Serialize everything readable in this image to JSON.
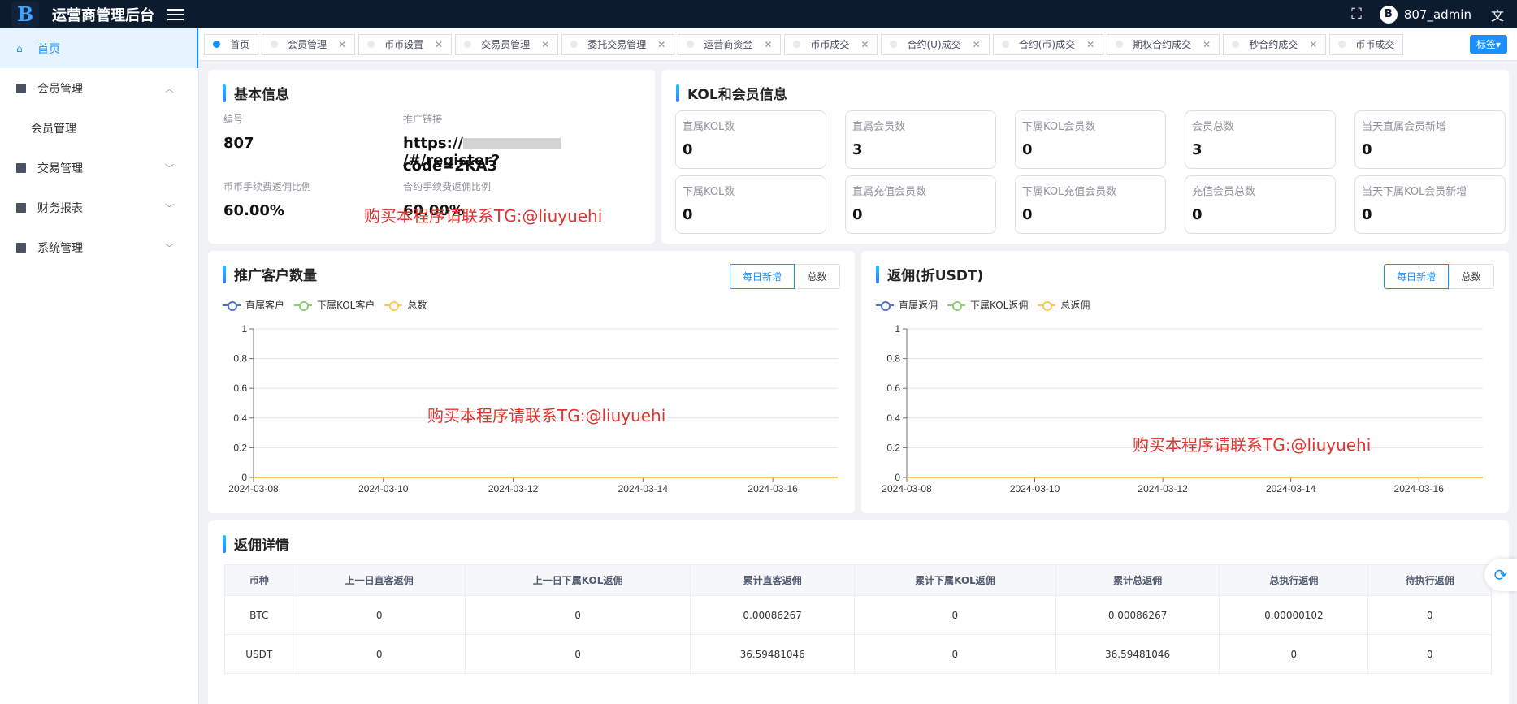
{
  "app": {
    "title": "运营商管理后台",
    "logo_letter": "B",
    "username": "807_admin",
    "avatar_letter": "B"
  },
  "sidebar": {
    "items": [
      {
        "label": "首页"
      },
      {
        "label": "会员管理"
      },
      {
        "label": "会员管理"
      },
      {
        "label": "交易管理"
      },
      {
        "label": "财务报表"
      },
      {
        "label": "系统管理"
      }
    ]
  },
  "tabs": [
    "首页",
    "会员管理",
    "币币设置",
    "交易员管理",
    "委托交易管理",
    "运营商资金",
    "币币成交",
    "合约(U)成交",
    "合约(币)成交",
    "期权合约成交",
    "秒合约成交",
    "币币成交"
  ],
  "tag_button": "标签",
  "basic_info": {
    "title": "基本信息",
    "id_label": "编号",
    "id_value": "807",
    "link_label": "推广链接",
    "link_value_1": "https://",
    "link_value_2": "/#/register?",
    "link_value_3": "code=2KA3",
    "coin_fee_label": "币币手续费返佣比例",
    "coin_fee_value": "60.00%",
    "contract_fee_label": "合约手续费返佣比例",
    "contract_fee_value": "60.00%"
  },
  "watermark": "购买本程序请联系TG:@liuyuehi",
  "kol": {
    "title": "KOL和会员信息",
    "boxes": [
      {
        "label": "直属KOL数",
        "value": "0"
      },
      {
        "label": "直属会员数",
        "value": "3"
      },
      {
        "label": "下属KOL会员数",
        "value": "0"
      },
      {
        "label": "会员总数",
        "value": "3"
      },
      {
        "label": "当天直属会员新增",
        "value": "0"
      },
      {
        "label": "下属KOL数",
        "value": "0"
      },
      {
        "label": "直属充值会员数",
        "value": "0"
      },
      {
        "label": "下属KOL充值会员数",
        "value": "0"
      },
      {
        "label": "充值会员总数",
        "value": "0"
      },
      {
        "label": "当天下属KOL会员新增",
        "value": "0"
      }
    ]
  },
  "promo_chart": {
    "title": "推广客户数量",
    "btn_daily": "每日新增",
    "btn_total": "总数"
  },
  "rebate_chart": {
    "title": "返佣(折USDT)",
    "btn_daily": "每日新增",
    "btn_total": "总数"
  },
  "chart_data": [
    {
      "type": "line",
      "x": [
        "2024-03-08",
        "2024-03-09",
        "2024-03-10",
        "2024-03-11",
        "2024-03-12",
        "2024-03-13",
        "2024-03-14",
        "2024-03-15",
        "2024-03-16",
        "2024-03-17"
      ],
      "x_tick_labels": [
        "2024-03-08",
        "2024-03-10",
        "2024-03-12",
        "2024-03-14",
        "2024-03-16"
      ],
      "series": [
        {
          "name": "直属客户",
          "color": "#5470c6",
          "values": [
            0,
            0,
            0,
            0,
            0,
            0,
            0,
            0,
            0,
            0
          ]
        },
        {
          "name": "下属KOL客户",
          "color": "#91cc75",
          "values": [
            0,
            0,
            0,
            0,
            0,
            0,
            0,
            0,
            0,
            0
          ]
        },
        {
          "name": "总数",
          "color": "#fac858",
          "values": [
            0,
            0,
            0,
            0,
            0,
            0,
            0,
            0,
            0,
            0
          ]
        }
      ],
      "ylim": [
        0,
        1
      ],
      "yticks": [
        0,
        0.2,
        0.4,
        0.6,
        0.8,
        1
      ],
      "grid": true,
      "legend": "top-left"
    },
    {
      "type": "line",
      "x": [
        "2024-03-08",
        "2024-03-09",
        "2024-03-10",
        "2024-03-11",
        "2024-03-12",
        "2024-03-13",
        "2024-03-14",
        "2024-03-15",
        "2024-03-16",
        "2024-03-17"
      ],
      "x_tick_labels": [
        "2024-03-08",
        "2024-03-10",
        "2024-03-12",
        "2024-03-14",
        "2024-03-16"
      ],
      "series": [
        {
          "name": "直属返佣",
          "color": "#5470c6",
          "values": [
            0,
            0,
            0,
            0,
            0,
            0,
            0,
            0,
            0,
            0
          ]
        },
        {
          "name": "下属KOL返佣",
          "color": "#91cc75",
          "values": [
            0,
            0,
            0,
            0,
            0,
            0,
            0,
            0,
            0,
            0
          ]
        },
        {
          "name": "总返佣",
          "color": "#fac858",
          "values": [
            0,
            0,
            0,
            0,
            0,
            0,
            0,
            0,
            0,
            0
          ]
        }
      ],
      "ylim": [
        0,
        1
      ],
      "yticks": [
        0,
        0.2,
        0.4,
        0.6,
        0.8,
        1
      ],
      "grid": true,
      "legend": "top-left"
    }
  ],
  "rebate_detail": {
    "title": "返佣详情",
    "columns": [
      "币种",
      "上一日直客返佣",
      "上一日下属KOL返佣",
      "累计直客返佣",
      "累计下属KOL返佣",
      "累计总返佣",
      "总执行返佣",
      "待执行返佣"
    ],
    "rows": [
      [
        "BTC",
        "0",
        "0",
        "0.00086267",
        "0",
        "0.00086267",
        "0.00000102",
        "0"
      ],
      [
        "USDT",
        "0",
        "0",
        "36.59481046",
        "0",
        "36.59481046",
        "0",
        "0"
      ]
    ]
  },
  "colors": {
    "accent": "#1890ff",
    "topbar": "#0d1b2e",
    "watermark": "#e2322d"
  }
}
